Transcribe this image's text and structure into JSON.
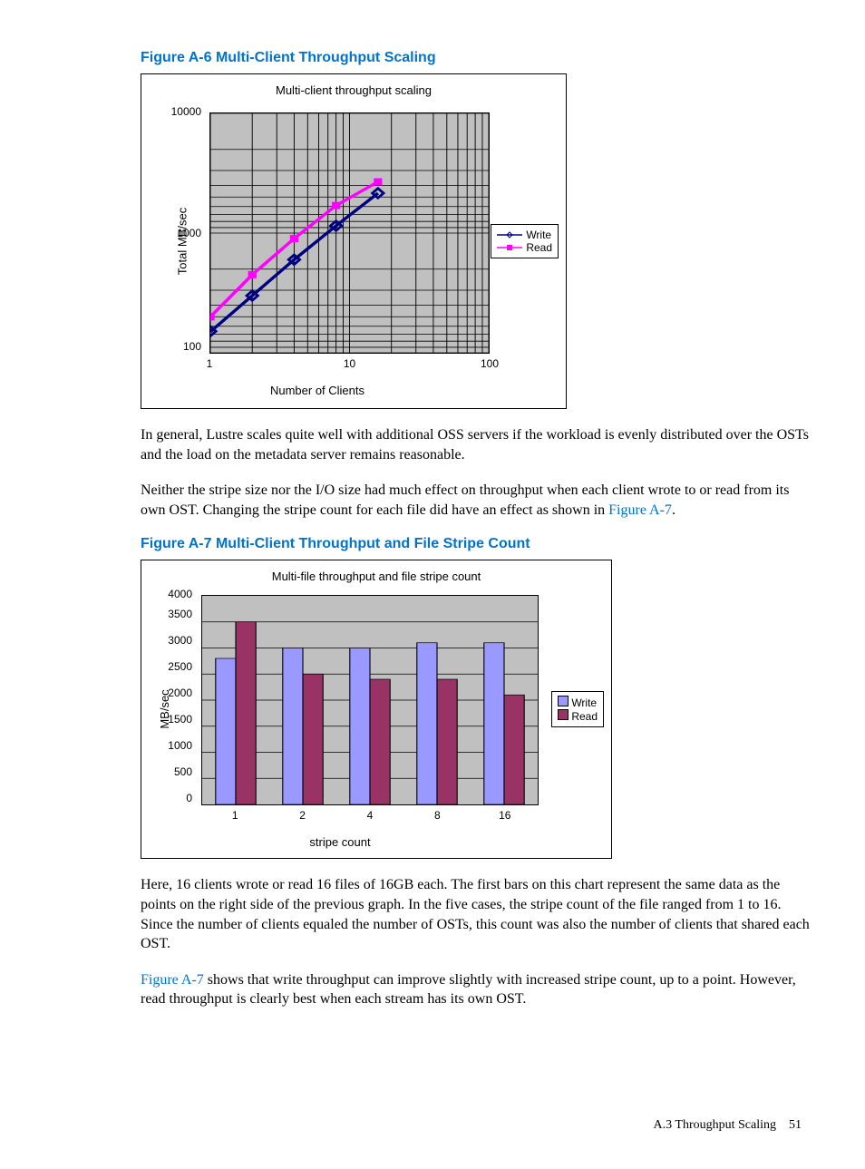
{
  "figA": {
    "caption": "Figure A-6 Multi-Client Throughput Scaling",
    "title": "Multi-client throughput scaling",
    "ylabel": "Total MB/sec",
    "xlabel": "Number of Clients",
    "legend": {
      "write": "Write",
      "read": "Read"
    },
    "xticks": [
      "1",
      "10",
      "100"
    ],
    "yticks": [
      "100",
      "1000",
      "10000"
    ]
  },
  "para1": "In general, Lustre scales quite well with additional OSS servers if the workload is evenly distributed over the OSTs and the load on the metadata server remains reasonable.",
  "para2_a": "Neither the stripe size nor the I/O size had much effect on throughput when each client wrote to or read from its own OST. Changing the stripe count for each file did have an effect as shown in ",
  "para2_link": "Figure A-7",
  "para2_b": ".",
  "figB": {
    "caption": "Figure A-7 Multi-Client Throughput and File Stripe Count",
    "title": "Multi-file throughput and file stripe count",
    "ylabel": "MB/sec",
    "xlabel": "stripe count",
    "legend": {
      "write": "Write",
      "read": "Read"
    },
    "xticks": [
      "1",
      "2",
      "4",
      "8",
      "16"
    ],
    "yticks": [
      "0",
      "500",
      "1000",
      "1500",
      "2000",
      "2500",
      "3000",
      "3500",
      "4000"
    ]
  },
  "para3": "Here, 16 clients wrote or read 16 files of 16GB each. The first bars on this chart represent the same data as the points on the right side of the previous graph. In the five cases, the stripe count of the file ranged from 1 to 16. Since the number of clients equaled the number of OSTs, this count was also the number of clients that shared each OST.",
  "para4_link": "Figure A-7",
  "para4": " shows that write throughput can improve slightly with increased stripe count, up to a point. However, read throughput is clearly best when each stream has its own OST.",
  "footer_section": "A.3 Throughput Scaling",
  "footer_page": "51",
  "chart_data": [
    {
      "type": "line",
      "title": "Multi-client throughput scaling",
      "xlabel": "Number of Clients",
      "ylabel": "Total MB/sec",
      "x_scale": "log",
      "y_scale": "log",
      "xlim": [
        1,
        100
      ],
      "ylim": [
        100,
        10000
      ],
      "x": [
        1,
        2,
        4,
        8,
        16
      ],
      "series": [
        {
          "name": "Write",
          "values": [
            150,
            300,
            600,
            1150,
            2150
          ]
        },
        {
          "name": "Read",
          "values": [
            200,
            450,
            900,
            1700,
            2600
          ]
        }
      ]
    },
    {
      "type": "bar",
      "title": "Multi-file throughput and file stripe count",
      "xlabel": "stripe count",
      "ylabel": "MB/sec",
      "ylim": [
        0,
        4000
      ],
      "categories": [
        "1",
        "2",
        "4",
        "8",
        "16"
      ],
      "series": [
        {
          "name": "Write",
          "values": [
            2800,
            3000,
            3000,
            3100,
            3100
          ]
        },
        {
          "name": "Read",
          "values": [
            3500,
            2500,
            2400,
            2400,
            2100
          ]
        }
      ]
    }
  ]
}
